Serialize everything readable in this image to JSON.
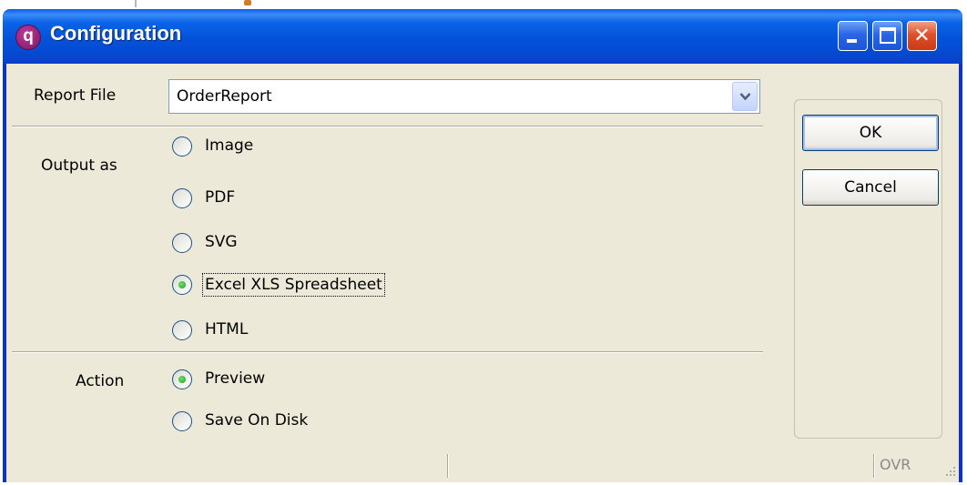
{
  "window": {
    "title": "Configuration",
    "icon": "app-logo-icon"
  },
  "report_file": {
    "label": "Report File",
    "value": "OrderReport"
  },
  "output": {
    "label": "Output as",
    "options": [
      {
        "label": "Image",
        "selected": false
      },
      {
        "label": "PDF",
        "selected": false
      },
      {
        "label": "SVG",
        "selected": false
      },
      {
        "label": "Excel XLS Spreadsheet",
        "selected": true
      },
      {
        "label": "HTML",
        "selected": false
      }
    ]
  },
  "action": {
    "label": "Action",
    "options": [
      {
        "label": "Preview",
        "selected": true
      },
      {
        "label": "Save On Disk",
        "selected": false
      }
    ]
  },
  "buttons": {
    "ok": "OK",
    "cancel": "Cancel"
  },
  "statusbar": {
    "mode": "OVR"
  },
  "colors": {
    "titlebar": "#0a57e0",
    "client": "#ece9d8",
    "close": "#e0502a"
  }
}
